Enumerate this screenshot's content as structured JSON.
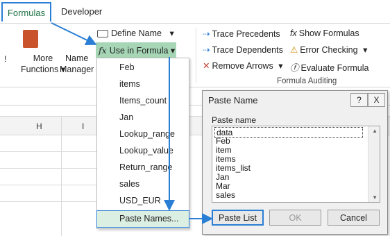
{
  "tabs": {
    "formulas": "Formulas",
    "developer": "Developer"
  },
  "ribbon": {
    "more_functions": [
      "More",
      "Functions"
    ],
    "name_manager": [
      "Name",
      "Manager"
    ],
    "define_name": "Define Name",
    "use_in_formula": "Use in Formula",
    "trace_precedents": "Trace Precedents",
    "trace_dependents": "Trace Dependents",
    "remove_arrows": "Remove Arrows",
    "show_formulas": "Show Formulas",
    "error_checking": "Error Checking",
    "evaluate_formula": "Evaluate Formula",
    "group_label": "Formula Auditing"
  },
  "grid": {
    "columns": [
      "H",
      "I"
    ]
  },
  "dropdown": {
    "items": [
      "Feb",
      "items",
      "Items_count",
      "Jan",
      "Lookup_range",
      "Lookup_value",
      "Return_range",
      "sales",
      "USD_EUR"
    ],
    "paste_names": "Paste Names..."
  },
  "dialog": {
    "title": "Paste Name",
    "help": "?",
    "close": "X",
    "label": "Paste name",
    "names": [
      "data",
      "Feb",
      "item",
      "items",
      "items_list",
      "Jan",
      "Mar",
      "sales"
    ],
    "buttons": {
      "paste_list": "Paste List",
      "ok": "OK",
      "cancel": "Cancel"
    }
  },
  "colors": {
    "accent_blue": "#2a7fd4",
    "highlight_green": "#a6d6b6",
    "excel_green": "#217346"
  }
}
